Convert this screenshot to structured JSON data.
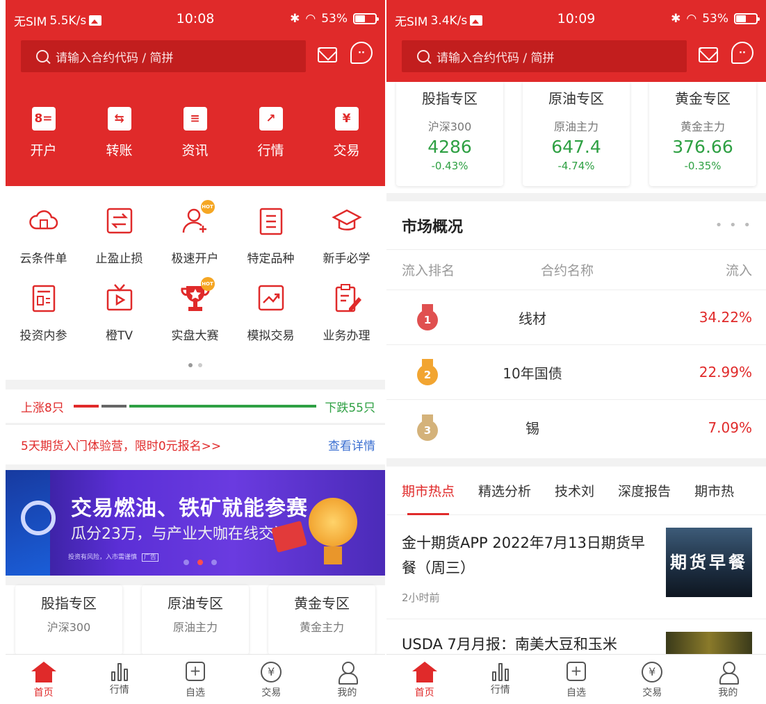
{
  "left": {
    "status": {
      "carrier": "无SIM",
      "speed": "5.5K/s",
      "time": "10:08",
      "battery": "53%"
    },
    "search_placeholder": "请输入合约代码 / 简拼",
    "quick_actions": [
      {
        "icon": "account-card-icon",
        "glyph": "8=",
        "label": "开户"
      },
      {
        "icon": "transfer-icon",
        "glyph": "⇆",
        "label": "转账"
      },
      {
        "icon": "document-icon",
        "glyph": "≡",
        "label": "资讯"
      },
      {
        "icon": "trend-chart-icon",
        "glyph": "↗",
        "label": "行情"
      },
      {
        "icon": "yen-icon",
        "glyph": "¥",
        "label": "交易"
      }
    ],
    "services_row1": [
      {
        "icon": "cloud-order-icon",
        "label": "云条件单"
      },
      {
        "icon": "stop-profit-loss-icon",
        "label": "止盈止损"
      },
      {
        "icon": "fast-account-icon",
        "label": "极速开户",
        "badge": "HOT"
      },
      {
        "icon": "special-variety-icon",
        "label": "特定品种"
      },
      {
        "icon": "graduation-cap-icon",
        "label": "新手必学"
      }
    ],
    "services_row2": [
      {
        "icon": "investment-reference-icon",
        "label": "投资内参"
      },
      {
        "icon": "tv-icon",
        "label": "橙TV"
      },
      {
        "icon": "trophy-icon",
        "label": "实盘大赛",
        "badge": "HOT"
      },
      {
        "icon": "simulated-trading-icon",
        "label": "模拟交易"
      },
      {
        "icon": "business-handling-icon",
        "label": "业务办理"
      }
    ],
    "ratio": {
      "up_label": "上涨8只",
      "down_label": "下跌55只",
      "up_count": 8,
      "down_count": 55
    },
    "promo": {
      "text": "5天期货入门体验营，限时0元报名>>",
      "link": "查看详情"
    },
    "banner": {
      "title": "交易燃油、铁矿就能参赛",
      "subtitle": "瓜分23万，与产业大咖在线交流",
      "note": "投资有风险，入市需谨慎",
      "ad_tag": "广告"
    },
    "zones": [
      {
        "name": "股指专区",
        "sub": "沪深300"
      },
      {
        "name": "原油专区",
        "sub": "原油主力"
      },
      {
        "name": "黄金专区",
        "sub": "黄金主力"
      }
    ]
  },
  "right": {
    "status": {
      "carrier": "无SIM",
      "speed": "3.4K/s",
      "time": "10:09",
      "battery": "53%"
    },
    "search_placeholder": "请输入合约代码 / 简拼",
    "zones": [
      {
        "name": "股指专区",
        "sub": "沪深300",
        "value": "4286",
        "change": "-0.43%"
      },
      {
        "name": "原油专区",
        "sub": "原油主力",
        "value": "647.4",
        "change": "-4.74%"
      },
      {
        "name": "黄金专区",
        "sub": "黄金主力",
        "value": "376.66",
        "change": "-0.35%"
      }
    ],
    "market": {
      "title": "市场概况",
      "more": "• • •",
      "columns": [
        "流入排名",
        "合约名称",
        "流入"
      ],
      "rows": [
        {
          "rank": "1",
          "name": "线材",
          "pct": "34.22%"
        },
        {
          "rank": "2",
          "name": "10年国债",
          "pct": "22.99%"
        },
        {
          "rank": "3",
          "name": "锡",
          "pct": "7.09%"
        }
      ]
    },
    "news_tabs": [
      "期市热点",
      "精选分析",
      "技术刘",
      "深度报告",
      "期市热"
    ],
    "news": [
      {
        "title": "金十期货APP 2022年7月13日期货早餐（周三）",
        "time": "2小时前",
        "thumb_text": "期货早餐"
      },
      {
        "title": "USDA 7月月报：南美大豆和玉米"
      }
    ]
  },
  "nav": [
    "首页",
    "行情",
    "自选",
    "交易",
    "我的"
  ],
  "colors": {
    "brand_red": "#e02a2a",
    "down_green": "#2ea043"
  }
}
